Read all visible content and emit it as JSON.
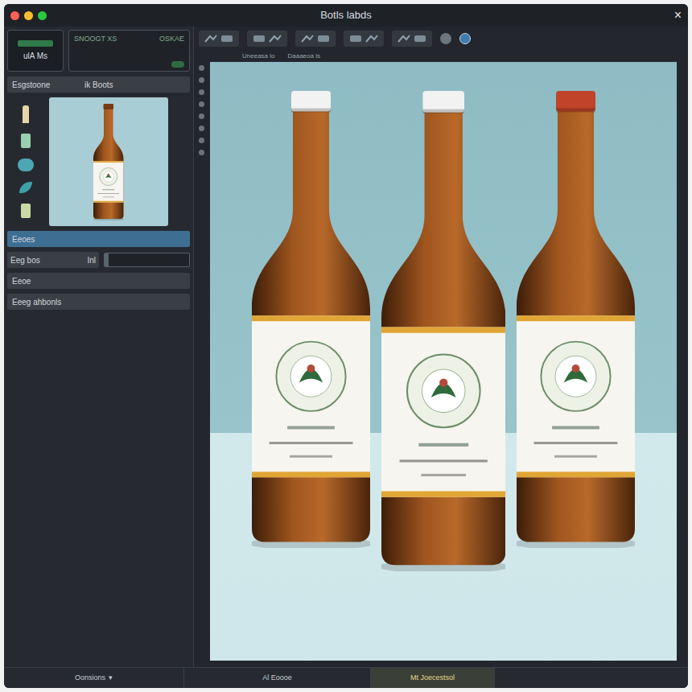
{
  "window": {
    "title": "Botls labds",
    "close": "×"
  },
  "sidebar": {
    "header": {
      "logo": "ulA Ms",
      "field_label": "SNOOGT XS",
      "field_value": "OSKAE"
    },
    "rows": [
      {
        "kind": "pair",
        "label": "Esgstoone",
        "value": "ik Boots",
        "selected": false
      },
      {
        "kind": "header",
        "label": "Eeoes",
        "selected": true
      },
      {
        "kind": "field",
        "label": "Eeg bos",
        "value": "Inl",
        "level": 0.05,
        "selected": false
      },
      {
        "kind": "header",
        "label": "Eeoe",
        "selected": false
      },
      {
        "kind": "header",
        "label": "Eeeg ahbonls",
        "selected": false
      }
    ]
  },
  "toolbar": {
    "path": [
      "Uneeasa lo",
      "Daaaeoa ls"
    ]
  },
  "canvas": {
    "bottles": [
      {
        "cap_color": "#f2f2f2"
      },
      {
        "cap_color": "#f2f2f2"
      },
      {
        "cap_color": "#c0432a"
      }
    ]
  },
  "status_bar": [
    {
      "label": "Oonsions",
      "caret": "▾",
      "selected": false
    },
    {
      "label": "Al Eoooe",
      "caret": "",
      "selected": false
    },
    {
      "label": "Mt Joecestsol",
      "caret": "",
      "selected": true
    }
  ]
}
